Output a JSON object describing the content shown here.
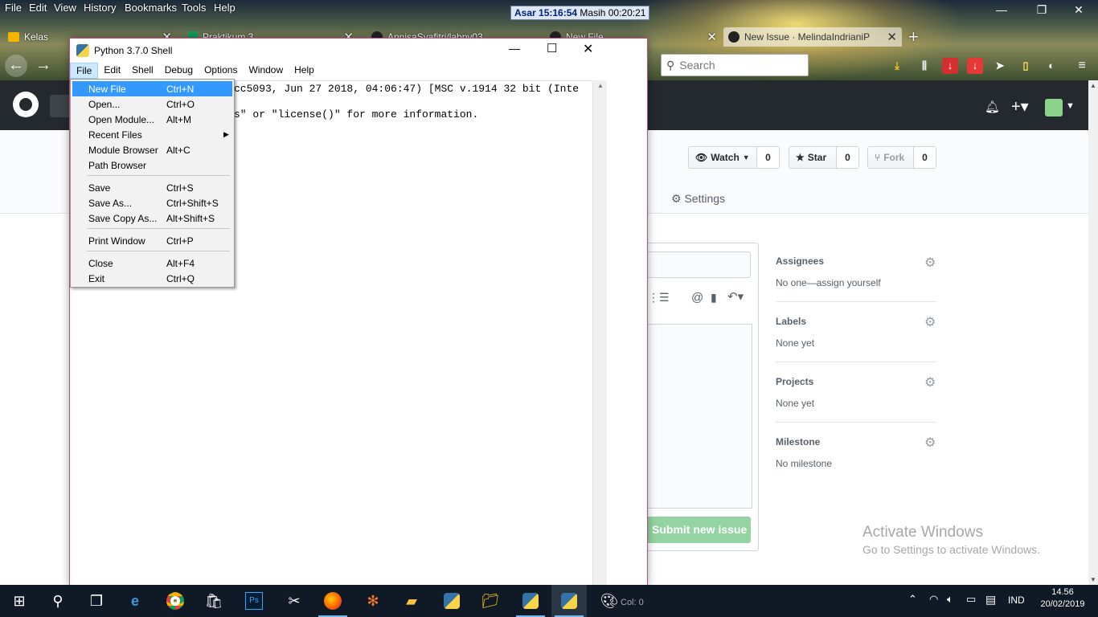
{
  "browser": {
    "menu": [
      "File",
      "Edit",
      "View",
      "History",
      "Bookmarks",
      "Tools",
      "Help"
    ],
    "clock": {
      "prayer": "Asar 15:16:54",
      "remaining": "Masih 00:20:21"
    },
    "tabs": [
      {
        "label": "Kelas",
        "icon": "classroom-icon"
      },
      {
        "label": "Praktikum 3",
        "icon": "sheets-icon"
      },
      {
        "label": "AnnisaSyafitri/labpy03",
        "icon": "github-icon"
      },
      {
        "label": "New File",
        "icon": "github-icon"
      },
      {
        "label": "New Issue · MelindaIndrianiP",
        "icon": "github-icon"
      }
    ],
    "new_tab_symbol": "+",
    "search_placeholder": "Search"
  },
  "github": {
    "watch": {
      "label": "Watch",
      "count": "0"
    },
    "star": {
      "label": "Star",
      "count": "0"
    },
    "fork": {
      "label": "Fork",
      "count": "0"
    },
    "settings_label": "Settings",
    "submit_label": "Submit new issue",
    "sidebar": [
      {
        "title": "Assignees",
        "value": "No one—assign yourself"
      },
      {
        "title": "Labels",
        "value": "None yet"
      },
      {
        "title": "Projects",
        "value": "None yet"
      },
      {
        "title": "Milestone",
        "value": "No milestone"
      }
    ]
  },
  "watermark": {
    "line1": "Activate Windows",
    "line2": "Go to Settings to activate Windows."
  },
  "idle": {
    "title": "Python 3.7.0 Shell",
    "menu": [
      "File",
      "Edit",
      "Shell",
      "Debug",
      "Options",
      "Window",
      "Help"
    ],
    "shell_line1": "cc5093, Jun 27 2018, 04:06:47) [MSC v.1914 32 bit (Inte",
    "shell_line2": "s\" or \"license()\" for more information.",
    "file_menu": [
      {
        "label": "New File",
        "shortcut": "Ctrl+N"
      },
      {
        "label": "Open...",
        "shortcut": "Ctrl+O"
      },
      {
        "label": "Open Module...",
        "shortcut": "Alt+M"
      },
      {
        "label": "Recent Files",
        "shortcut": ""
      },
      {
        "label": "Module Browser",
        "shortcut": "Alt+C"
      },
      {
        "label": "Path Browser",
        "shortcut": ""
      },
      {
        "label": "Save",
        "shortcut": "Ctrl+S"
      },
      {
        "label": "Save As...",
        "shortcut": "Ctrl+Shift+S"
      },
      {
        "label": "Save Copy As...",
        "shortcut": "Alt+Shift+S"
      },
      {
        "label": "Print Window",
        "shortcut": "Ctrl+P"
      },
      {
        "label": "Close",
        "shortcut": "Alt+F4"
      },
      {
        "label": "Exit",
        "shortcut": "Ctrl+Q"
      }
    ]
  },
  "taskbar": {
    "status_text": "Col: 0",
    "lang": "IND",
    "time": "14.56",
    "date": "20/02/2019"
  }
}
